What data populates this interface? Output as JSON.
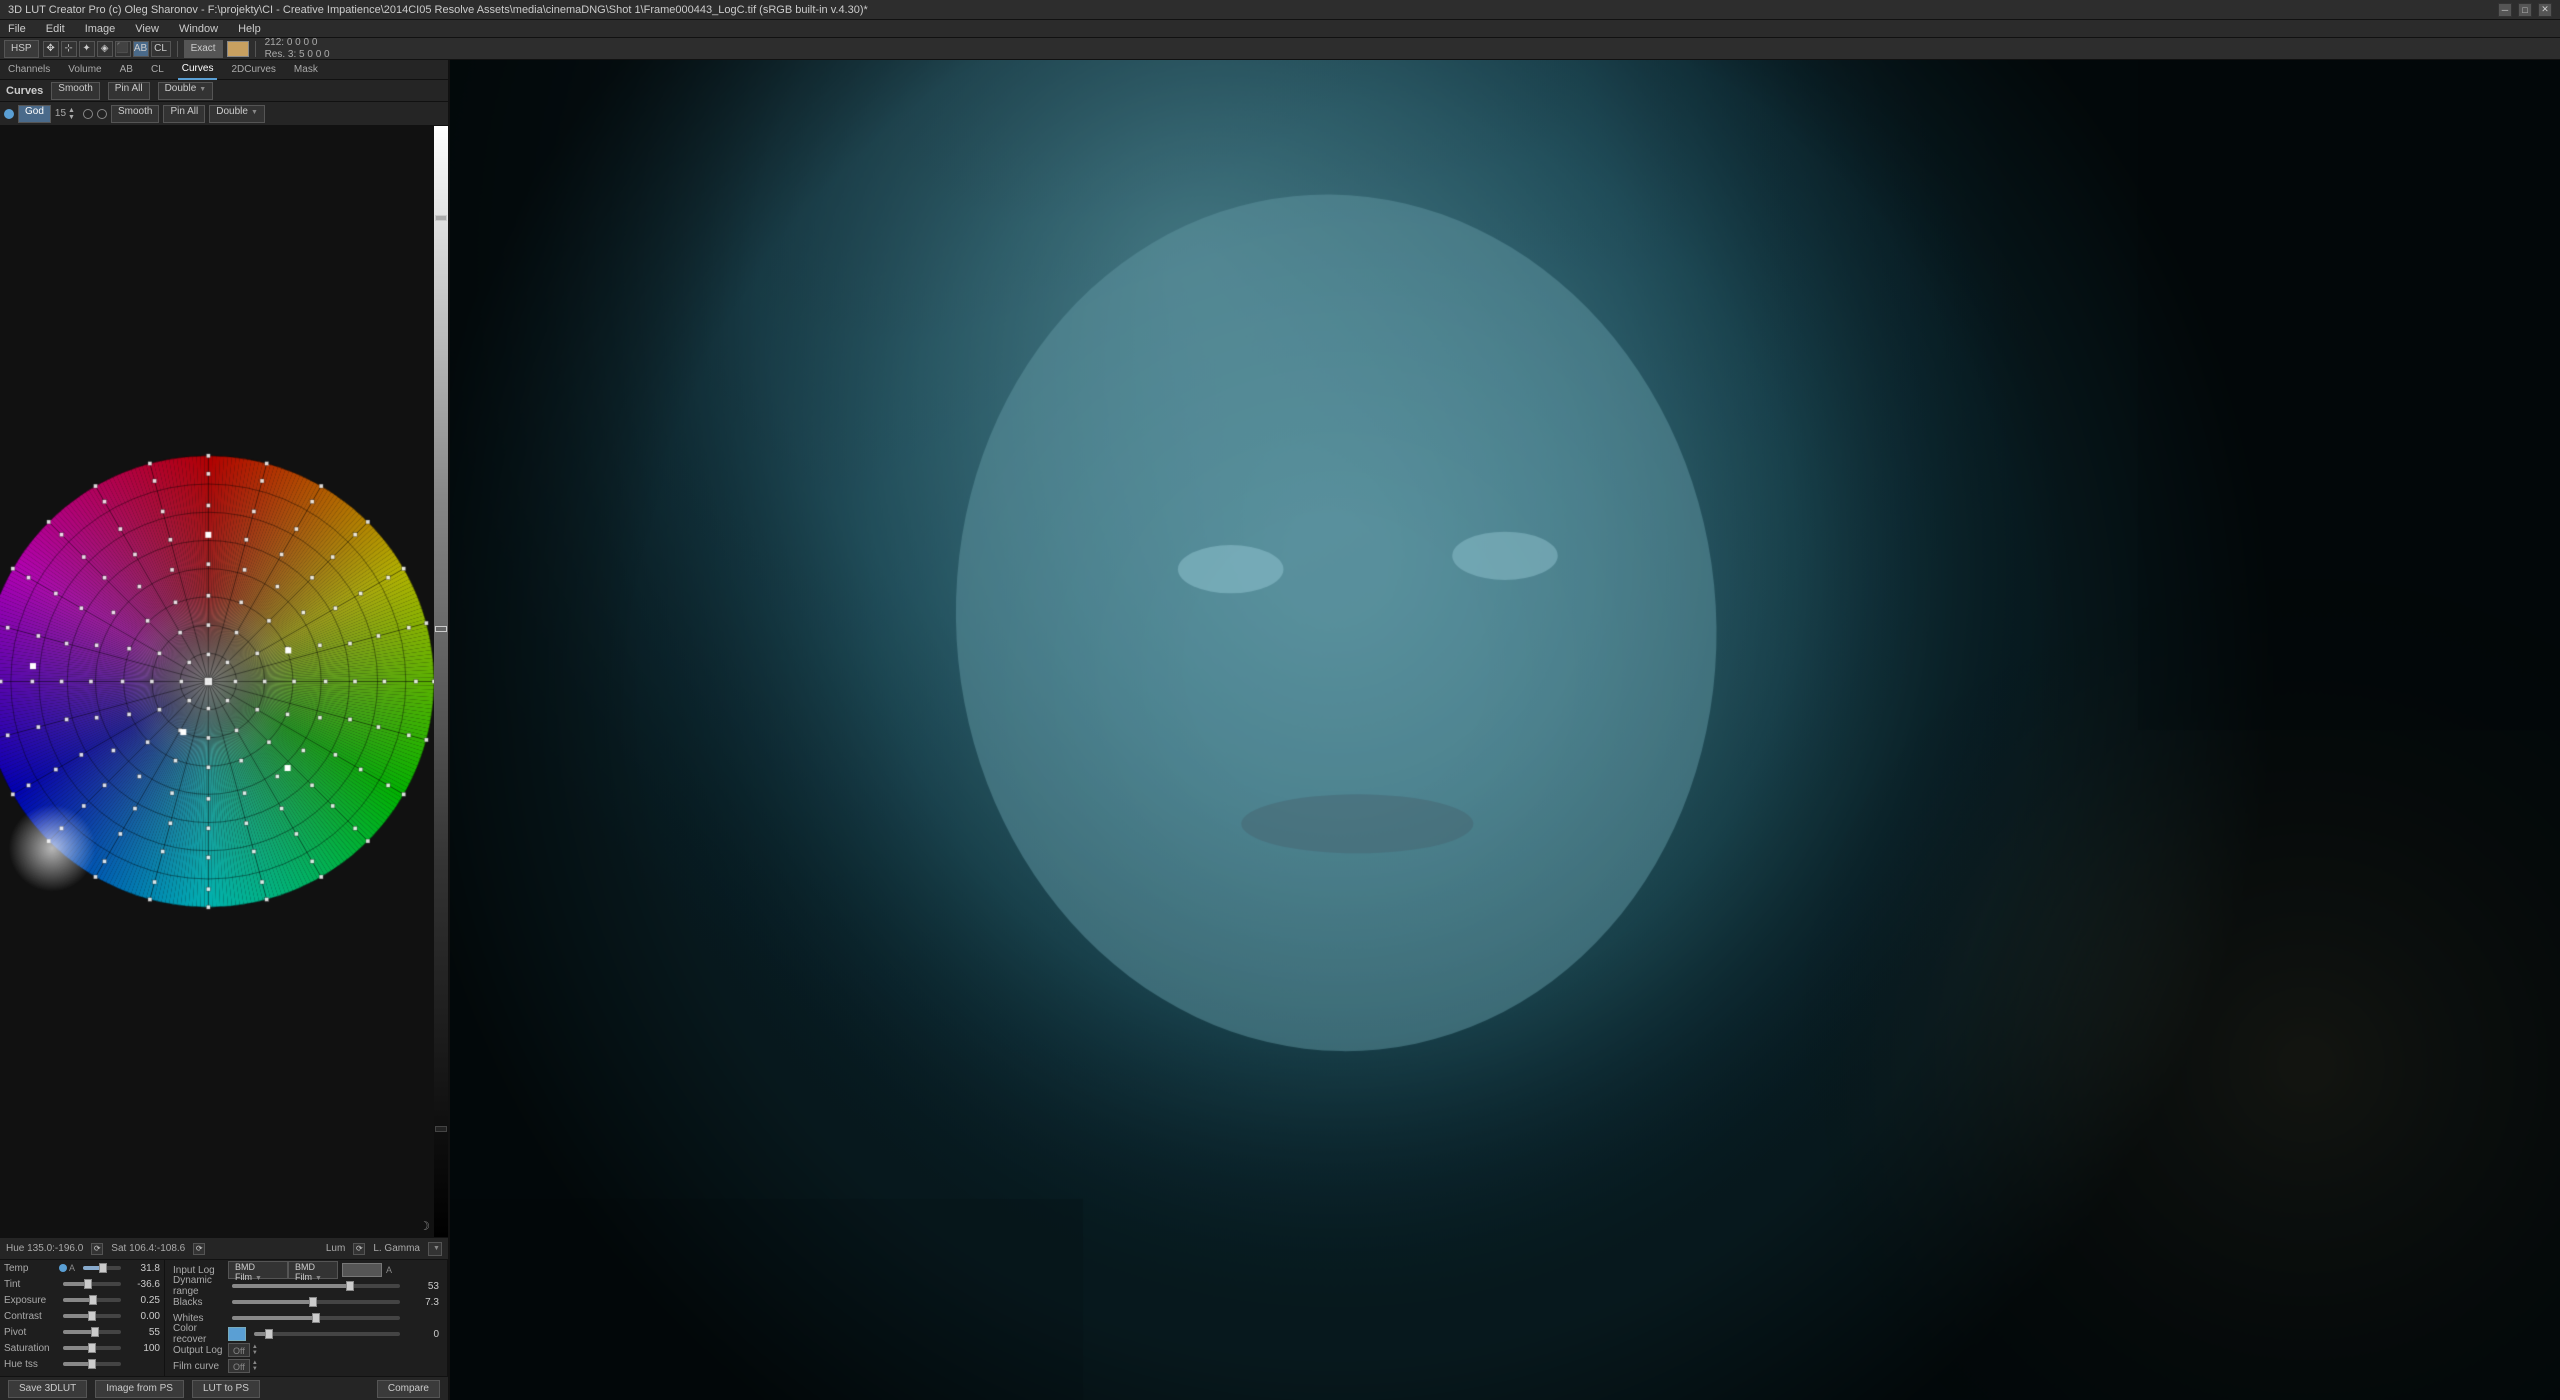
{
  "window": {
    "title": "3D LUT Creator Pro (c) Oleg Sharonov - F:\\projekty\\CI - Creative Impatience\\2014CI05 Resolve Assets\\media\\cinemaDNG\\Shot 1\\Frame000443_LogC.tif (sRGB built-in v.4.30)*",
    "minimize": "─",
    "maximize": "□",
    "close": "✕"
  },
  "menu": {
    "items": [
      "File",
      "Edit",
      "Image",
      "View",
      "Window",
      "Help"
    ]
  },
  "toolbar": {
    "hsp_label": "HSP",
    "exact_label": "Exact",
    "stats_line1": "212: 0  0  0  0",
    "stats_line2": "Res. 3:  5  0  0  0"
  },
  "panel_tabs": {
    "channels": "Channels",
    "volume": "Volume",
    "ab": "AB",
    "cl": "CL",
    "curves": "Curves",
    "twod_curves": "2DCurves",
    "mask": "Mask"
  },
  "curves_header": {
    "title": "Curves",
    "smooth_label": "Smooth",
    "pin_all_label": "Pin All",
    "double_label": "Double"
  },
  "tool_row": {
    "god_label": "God",
    "num_val": "15",
    "radio1": "circle",
    "radio2": "square"
  },
  "sliders": {
    "temp": {
      "label": "Temp",
      "value": "31.8",
      "pct": 52
    },
    "tint": {
      "label": "Tint",
      "value": "-36.6",
      "pct": 43
    },
    "exposure": {
      "label": "Exposure",
      "value": "0.25",
      "pct": 51
    },
    "contrast": {
      "label": "Contrast",
      "value": "0.00",
      "pct": 50
    },
    "pivot": {
      "label": "Pivot",
      "value": "55",
      "pct": 55
    },
    "saturation": {
      "label": "Saturation",
      "value": "100",
      "pct": 50
    },
    "hue_tss": {
      "label": "Hue tss",
      "value": "",
      "pct": 50
    }
  },
  "right_sliders": {
    "input_log": {
      "label": "Input Log",
      "value": "BMD Film"
    },
    "dynamic_range": {
      "label": "Dynamic range",
      "value": "53",
      "pct": 70
    },
    "blacks": {
      "label": "Blacks",
      "value": "7.3",
      "pct": 48
    },
    "whites": {
      "label": "Whites",
      "value": "",
      "pct": 50
    },
    "color_recover": {
      "label": "Color recover",
      "value": "0",
      "pct": 10
    },
    "output_log": {
      "label": "Output Log",
      "value": "Off"
    },
    "film_curve": {
      "label": "Film curve",
      "value": "Off"
    }
  },
  "status_bar": {
    "hue": "Hue 135.0:-196.0",
    "sat": "Sat 106.4:-108.6",
    "lum": "Lum",
    "l_gamma": "L. Gamma"
  },
  "bottom_actions": {
    "save_3dlut": "Save 3DLUT",
    "image_from_ps": "Image from PS",
    "lut_to_ps": "LUT to PS",
    "compare": "Compare"
  },
  "colors": {
    "accent_blue": "#5a9fd4",
    "background_dark": "#1e1e1e",
    "panel_bg": "#232323",
    "border": "#111111"
  }
}
